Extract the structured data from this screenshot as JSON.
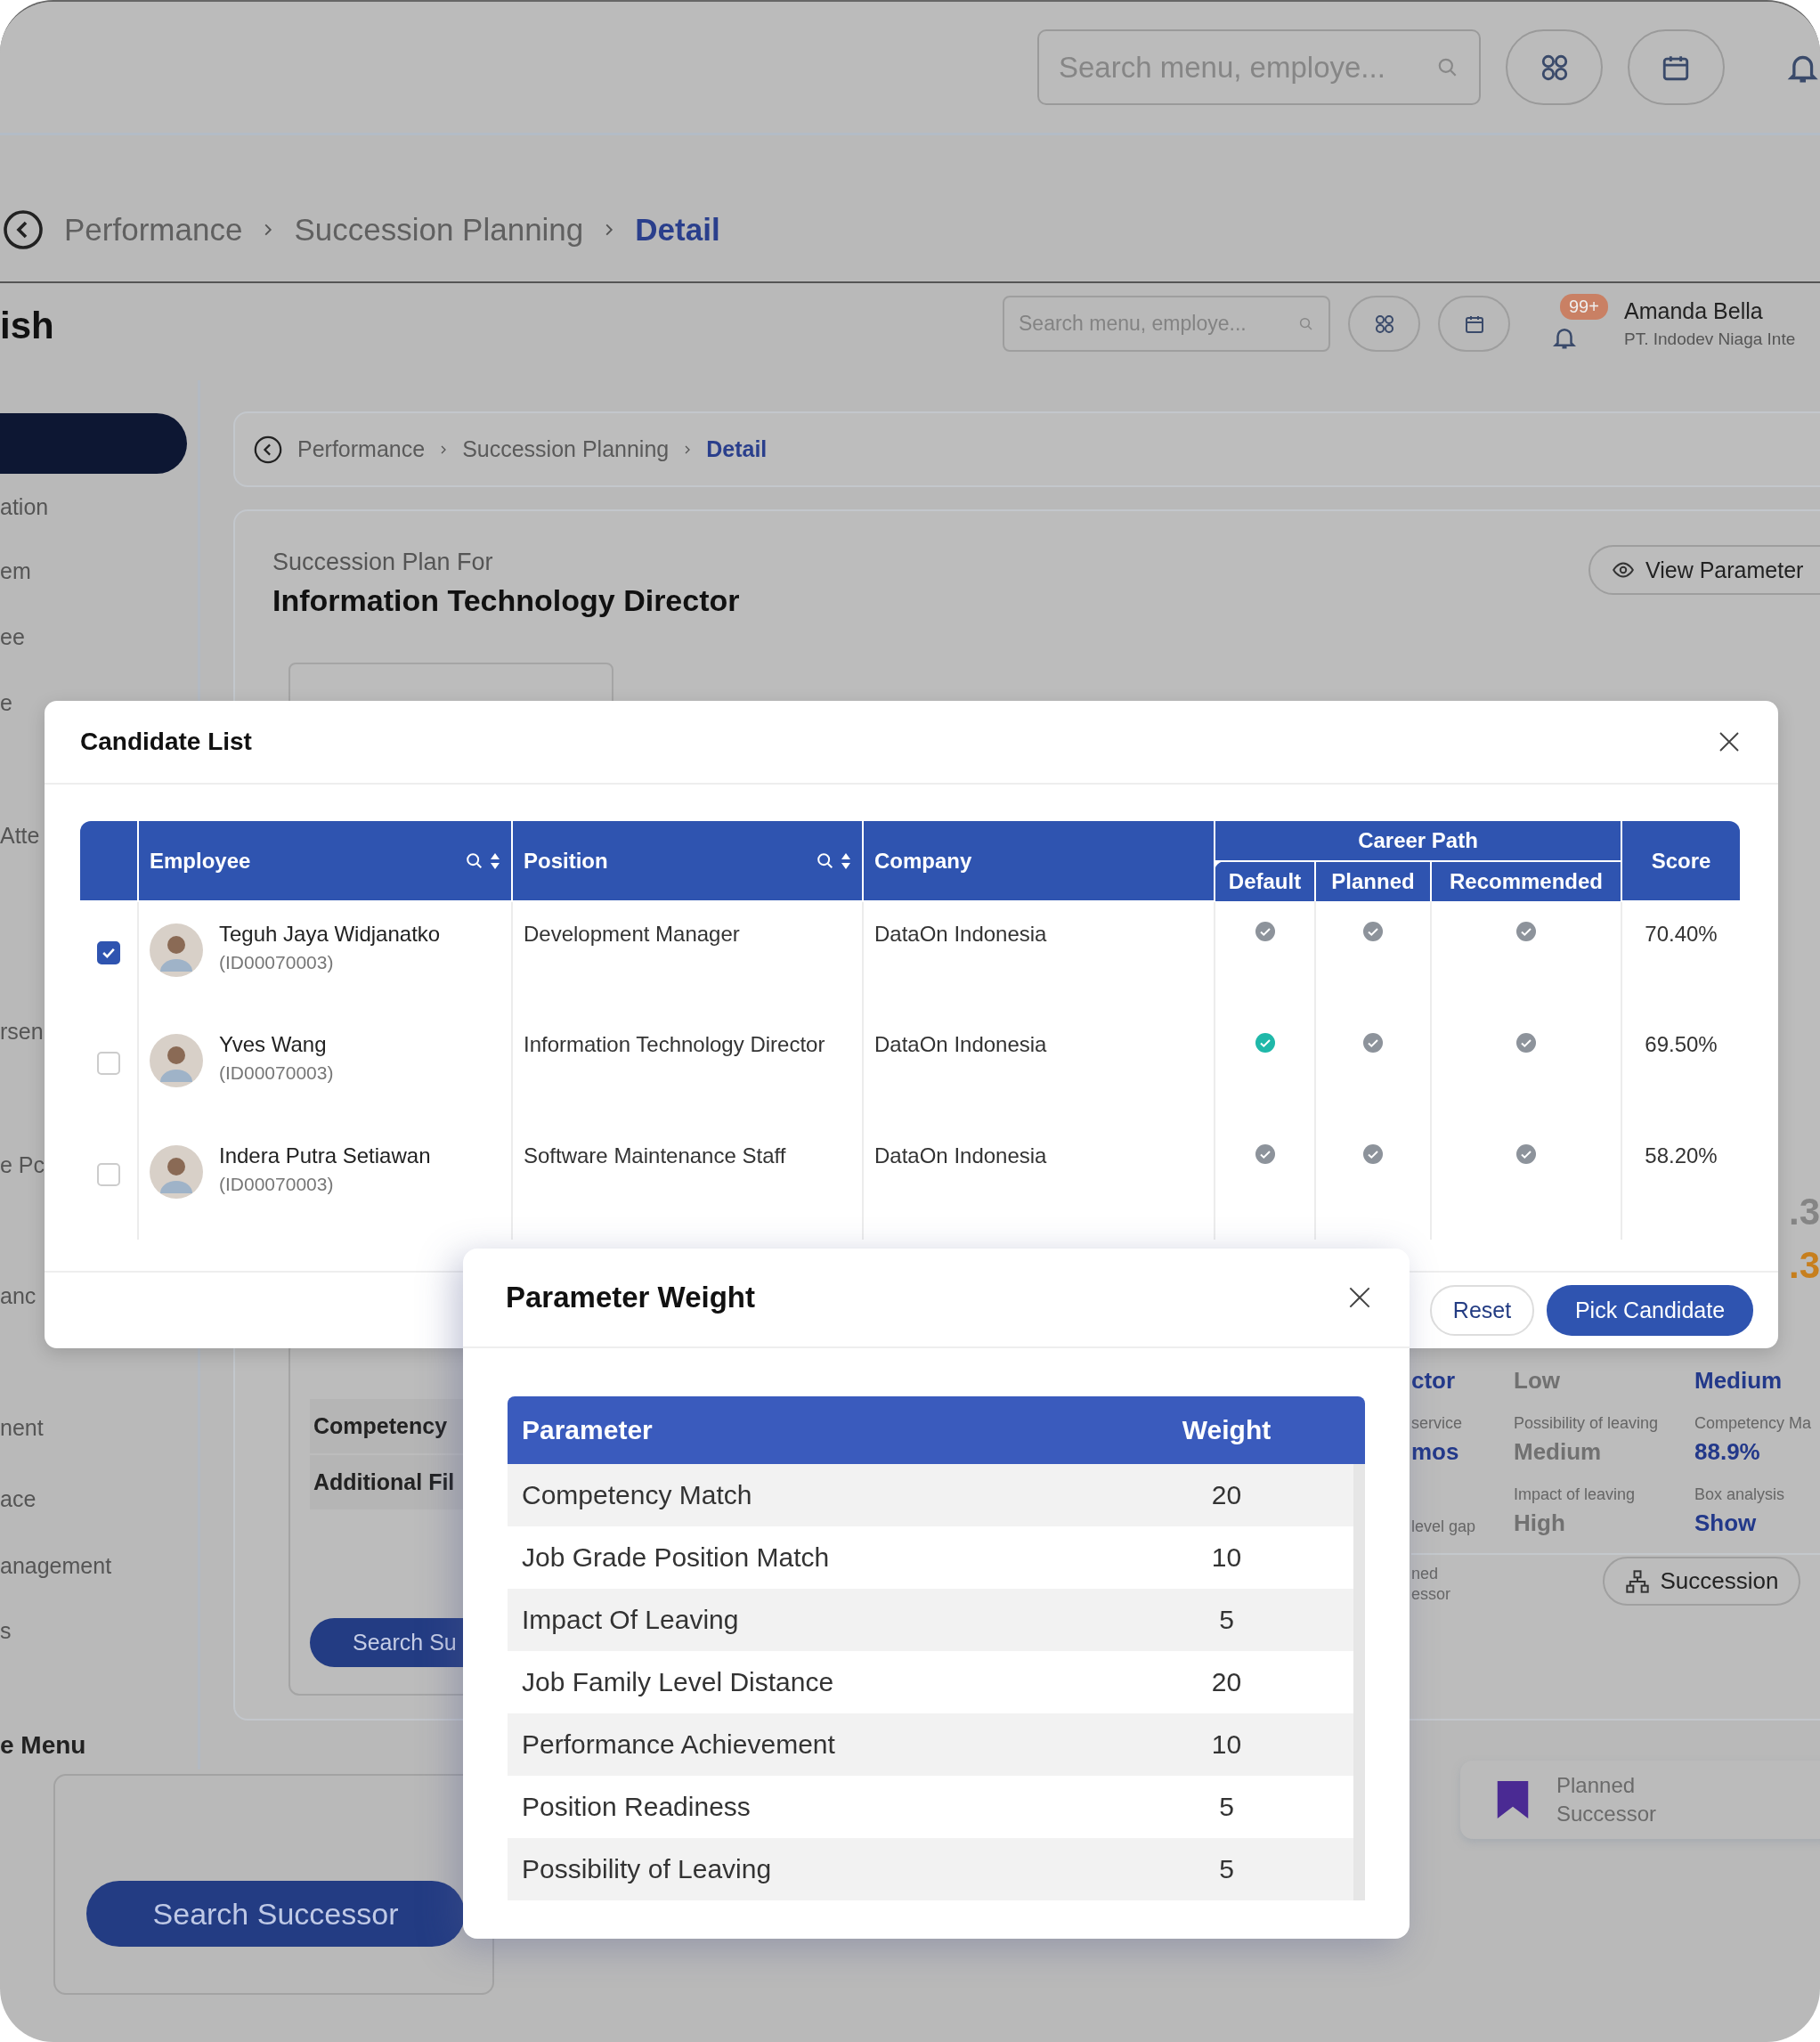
{
  "outer_header": {
    "search": {
      "placeholder": "Search menu, employe..."
    }
  },
  "outer_breadcrumb": [
    {
      "label": "Performance",
      "current": false
    },
    {
      "label": "Succession Planning",
      "current": false
    },
    {
      "label": "Detail",
      "current": true
    }
  ],
  "inner_header": {
    "logo_text": "ish",
    "search": {
      "placeholder": "Search menu, employe..."
    },
    "notification_badge": "99+",
    "user_name": "Amanda Bella",
    "user_company": "PT. Indodev Niaga Inte"
  },
  "sidebar": {
    "items": [
      {
        "selected": true
      },
      {
        "label": "ation",
        "selected": false
      },
      {
        "label": "em",
        "selected": false
      },
      {
        "label": "ee",
        "selected": false
      },
      {
        "label": "e",
        "selected": false
      },
      {
        "label": "Atte",
        "selected": false
      },
      {
        "label": "rsen",
        "selected": false
      },
      {
        "label": "e Pc",
        "selected": false
      },
      {
        "label": "anc",
        "selected": false
      },
      {
        "label": "nent",
        "selected": false
      },
      {
        "label": "ace",
        "selected": false
      },
      {
        "label": "anagement",
        "selected": false
      },
      {
        "label": "s",
        "selected": false
      }
    ],
    "section_label": "e Menu"
  },
  "inner_breadcrumb": [
    {
      "label": "Performance",
      "current": false
    },
    {
      "label": "Succession Planning",
      "current": false
    },
    {
      "label": "Detail",
      "current": true
    }
  ],
  "plan": {
    "caption": "Succession Plan For",
    "title": "Information Technology Director",
    "view_button": "View Parameter",
    "filter_rows": [
      "Competency",
      "Additional Fil"
    ],
    "small_search_button": "Search Su",
    "search_button": "Search Successor"
  },
  "details": {
    "scores": [
      ".3",
      ".3"
    ],
    "columns": [
      {
        "fields": [
          {
            "value": "ctor"
          },
          {
            "label": "service",
            "value": "mos"
          },
          {
            "label": "level gap"
          }
        ]
      },
      {
        "fields": [
          {
            "value": "Low"
          },
          {
            "label": "Possibility of leaving",
            "value": "Medium"
          },
          {
            "label": "Impact of leaving",
            "value": "High"
          }
        ]
      },
      {
        "fields": [
          {
            "value": "Medium"
          },
          {
            "label": "Competency Ma",
            "value": "88.9%"
          },
          {
            "label": "Box analysis",
            "value": "Show"
          }
        ]
      }
    ],
    "footer_lines": [
      "ned",
      "essor"
    ],
    "succession_button": "Succession",
    "planned_card": {
      "line_1": "Planned",
      "line_2": "Successor"
    }
  },
  "candidate_dialog": {
    "title": "Candidate List",
    "columns": {
      "employee": "Employee",
      "position": "Position",
      "company": "Company",
      "career_path": "Career Path",
      "default": "Default",
      "planned": "Planned",
      "recommended": "Recommended",
      "score": "Score"
    },
    "rows": [
      {
        "selected": true,
        "name": "Teguh Jaya Widjanatko",
        "id": "(ID00070003)",
        "position": "Development Manager",
        "company": "DataOn Indonesia",
        "default": false,
        "planned": false,
        "recommended": false,
        "score": "70.40%"
      },
      {
        "selected": false,
        "name": "Yves Wang",
        "id": "(ID00070003)",
        "position": "Information Technology Director",
        "company": "DataOn Indonesia",
        "default": true,
        "planned": false,
        "recommended": false,
        "score": "69.50%"
      },
      {
        "selected": false,
        "name": "Indera Putra Setiawan",
        "id": "(ID00070003)",
        "position": "Software Maintenance Staff",
        "company": "DataOn Indonesia",
        "default": false,
        "planned": false,
        "recommended": false,
        "score": "58.20%"
      }
    ],
    "buttons": {
      "reset": "Reset",
      "pick": "Pick Candidate"
    }
  },
  "parameter_dialog": {
    "title": "Parameter Weight",
    "columns": [
      "Parameter",
      "Weight"
    ],
    "rows": [
      {
        "parameter": "Competency Match",
        "weight": "20"
      },
      {
        "parameter": "Job Grade Position Match",
        "weight": "10"
      },
      {
        "parameter": "Impact Of Leaving",
        "weight": "5"
      },
      {
        "parameter": "Job Family Level Distance",
        "weight": "20"
      },
      {
        "parameter": "Performance Achievement",
        "weight": "10"
      },
      {
        "parameter": "Position Readiness",
        "weight": "5"
      },
      {
        "parameter": "Possibility of Leaving",
        "weight": "5"
      }
    ]
  }
}
